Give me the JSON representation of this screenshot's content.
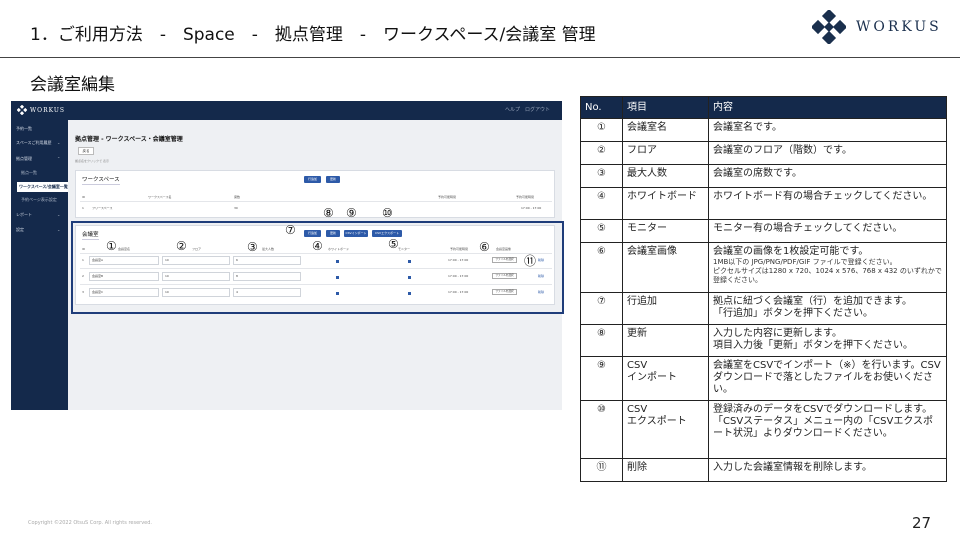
{
  "slide": {
    "title": "1．ご利用方法　-　Space　-　拠点管理　-　ワークスペース/会議室 管理",
    "section_title": "会議室編集",
    "logo_text": "WORKUS",
    "copyright": "Copyright ©2022 OtsuS Corp. All rights reserved.",
    "page_number": "27"
  },
  "colors": {
    "navy": "#14294b",
    "button_blue": "#2d5aa8",
    "highlight_border": "#1f3d7a"
  },
  "screenshot": {
    "logo_text": "WORKUS",
    "top_right": "ヘルプ　ログアウト",
    "sidebar": {
      "items": [
        {
          "label": "予約一覧"
        },
        {
          "label": "スペースご利用履歴"
        },
        {
          "label": "拠点管理"
        },
        {
          "label": "拠点一覧"
        },
        {
          "label": "ワークスペース/会議室一覧"
        },
        {
          "label": "予約ページ表示設定"
        },
        {
          "label": "レポート"
        },
        {
          "label": "設定"
        }
      ]
    },
    "page_title": "拠点管理 - ワークスペース・会議室管理",
    "back_button": "戻る",
    "note": "拠点名をクリックで 表示",
    "workspace": {
      "title": "ワークスペース",
      "buttons": [
        "行追加",
        "更新"
      ],
      "headers": [
        "ID",
        "ワークスペース名",
        "席数",
        "予約可能時間",
        "予約可能時間"
      ],
      "row": {
        "id": "1",
        "name": "フリースペース",
        "seats": "30",
        "time": "17:00 - 17:00"
      }
    },
    "meeting_room": {
      "title": "会議室",
      "buttons": [
        "行追加",
        "更新",
        "CSVインポート",
        "CSVエクスポート"
      ],
      "headers": [
        "ID",
        "会議室名",
        "フロア",
        "最大人数",
        "ホワイトボード",
        "モニター",
        "予約可能時間",
        "会議室画像"
      ],
      "rows": [
        {
          "id": "1",
          "name": "会議室A",
          "floor": "10",
          "capacity": "6",
          "time": "17:00 - 17:00",
          "file_button": "ファイルを選択",
          "delete": "削除"
        },
        {
          "id": "2",
          "name": "会議室B",
          "floor": "10",
          "capacity": "8",
          "time": "17:00 - 17:00",
          "file_button": "ファイルを選択",
          "delete": "削除"
        },
        {
          "id": "3",
          "name": "会議室C",
          "floor": "10",
          "capacity": "4",
          "time": "17:00 - 17:00",
          "file_button": "ファイルを選択",
          "delete": "削除"
        }
      ]
    },
    "markers": [
      "①",
      "②",
      "③",
      "④",
      "⑤",
      "⑥",
      "⑦",
      "⑧",
      "⑨",
      "⑩",
      "⑪"
    ]
  },
  "table": {
    "headers": [
      "No.",
      "項目",
      "内容"
    ],
    "rows": [
      {
        "no": "①",
        "item": "会議室名",
        "content": "会議室名です。",
        "sub": ""
      },
      {
        "no": "②",
        "item": "フロア",
        "content": "会議室のフロア（階数）です。",
        "sub": ""
      },
      {
        "no": "③",
        "item": "最大人数",
        "content": "会議室の席数です。",
        "sub": ""
      },
      {
        "no": "④",
        "item": "ホワイトボード",
        "content": "ホワイトボード有の場合チェックしてください。",
        "sub": ""
      },
      {
        "no": "⑤",
        "item": "モニター",
        "content": "モニター有の場合チェックしてください。",
        "sub": ""
      },
      {
        "no": "⑥",
        "item": "会議室画像",
        "content": "会議室の画像を1枚設定可能です。",
        "sub": "1MB以下の JPG/PNG/PDF/GIF ファイルで登録ください。\nピクセルサイズは1280 x 720、1024 x 576、768 x 432 のいずれかで登録ください。"
      },
      {
        "no": "⑦",
        "item": "行追加",
        "content": "拠点に紐づく会議室（行）を追加できます。\n「行追加」ボタンを押下ください。",
        "sub": ""
      },
      {
        "no": "⑧",
        "item": "更新",
        "content": "入力した内容に更新します。\n項目入力後「更新」ボタンを押下ください。",
        "sub": ""
      },
      {
        "no": "⑨",
        "item": "CSV\nインポート",
        "content": "会議室をCSVでインポート（※）を行います。CSVダウンロードで落としたファイルをお使いください。",
        "sub": ""
      },
      {
        "no": "⑩",
        "item": "CSV\nエクスポート",
        "content": "登録済みのデータをCSVでダウンロードします。「CSVステータス」メニュー内の「CSVエクスポート状況」よりダウンロードください。",
        "sub": ""
      },
      {
        "no": "⑪",
        "item": "削除",
        "content": "入力した会議室情報を削除します。",
        "sub": ""
      }
    ]
  }
}
